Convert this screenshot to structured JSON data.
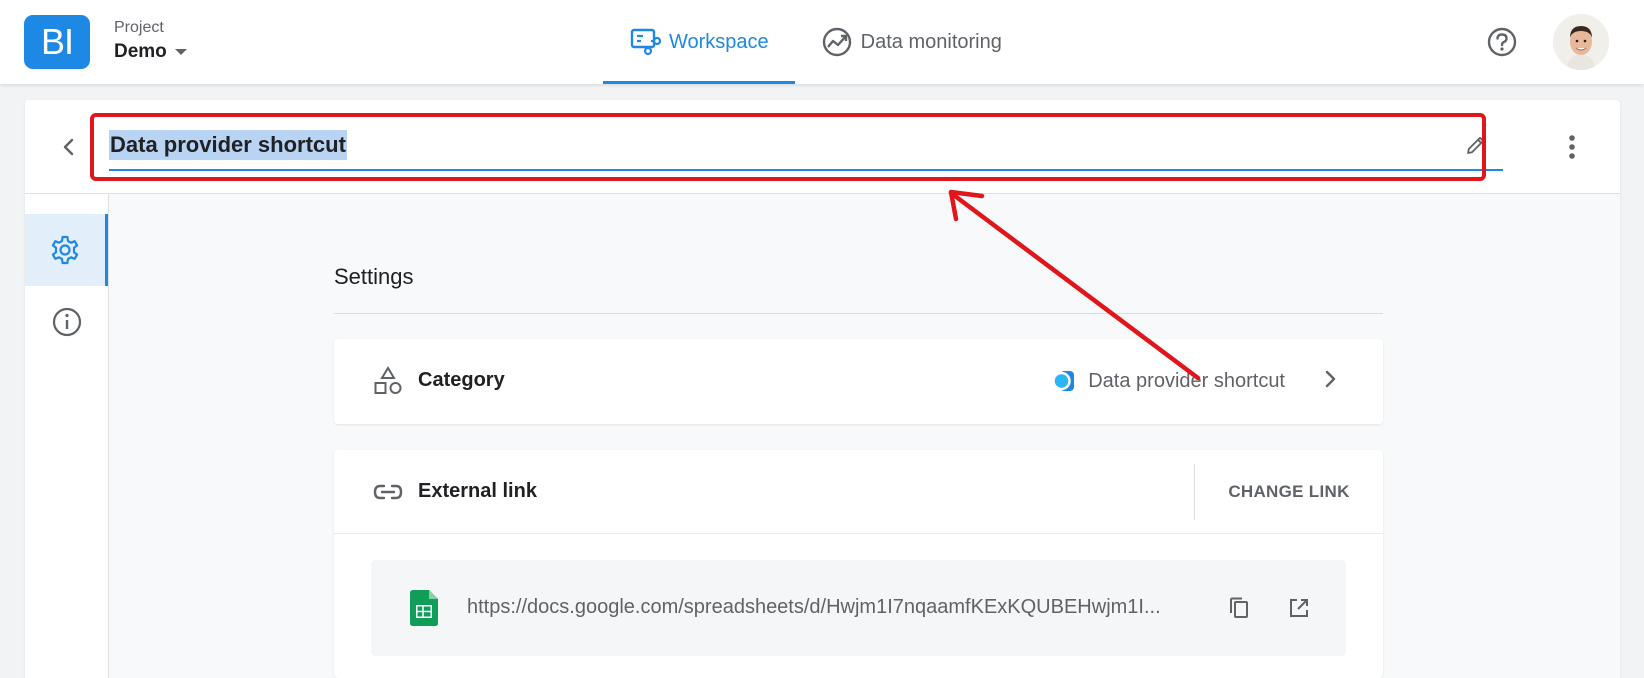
{
  "header": {
    "logo_text": "BI",
    "project_label": "Project",
    "project_name": "Demo",
    "tabs": [
      {
        "label": "Workspace",
        "active": true,
        "icon": "workspace-icon"
      },
      {
        "label": "Data monitoring",
        "active": false,
        "icon": "monitoring-icon"
      }
    ],
    "help_icon": "help-icon",
    "avatar_icon": "user-avatar"
  },
  "editor": {
    "title": "Data provider shortcut",
    "back_icon": "chevron-left-icon",
    "edit_icon": "pencil-icon",
    "more_icon": "more-vert-icon"
  },
  "sidebar": {
    "items": [
      {
        "icon": "gear-icon",
        "active": true
      },
      {
        "icon": "info-icon",
        "active": false
      }
    ]
  },
  "settings": {
    "title": "Settings",
    "category": {
      "label": "Category",
      "value": "Data provider shortcut",
      "icon": "shapes-icon"
    },
    "external_link": {
      "label": "External link",
      "action": "CHANGE LINK",
      "url": "https://docs.google.com/spreadsheets/d/Hwjm1I7nqaamfKExKQUBEHwjm1I...",
      "icon": "link-icon",
      "file_icon": "google-sheets-icon"
    }
  },
  "colors": {
    "accent": "#1e88e5",
    "annotation": "#e0161b",
    "sheets_green": "#0f9d58"
  }
}
